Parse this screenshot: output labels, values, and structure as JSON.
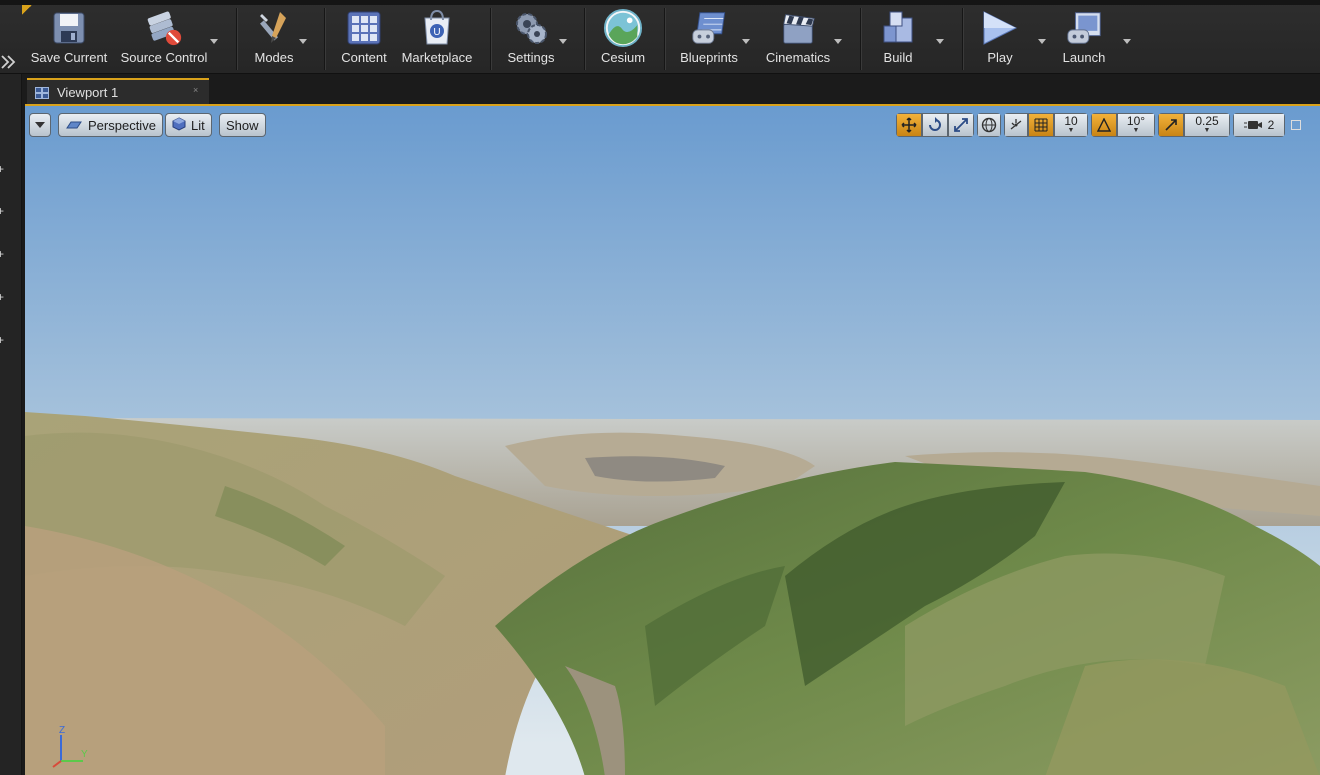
{
  "toolbar": {
    "buttons": [
      {
        "label": "Save Current",
        "icon": "save-icon"
      },
      {
        "label": "Source Control",
        "icon": "source-control-icon"
      },
      {
        "label": "Modes",
        "icon": "modes-icon"
      },
      {
        "label": "Content",
        "icon": "content-icon"
      },
      {
        "label": "Marketplace",
        "icon": "marketplace-icon"
      },
      {
        "label": "Settings",
        "icon": "settings-icon"
      },
      {
        "label": "Cesium",
        "icon": "cesium-icon"
      },
      {
        "label": "Blueprints",
        "icon": "blueprints-icon"
      },
      {
        "label": "Cinematics",
        "icon": "cinematics-icon"
      },
      {
        "label": "Build",
        "icon": "build-icon"
      },
      {
        "label": "Play",
        "icon": "play-icon"
      },
      {
        "label": "Launch",
        "icon": "launch-icon"
      }
    ]
  },
  "tabs": [
    {
      "label": "Viewport 1"
    }
  ],
  "viewport": {
    "view_mode": "Perspective",
    "lighting": "Lit",
    "show": "Show",
    "grid_snap": "10",
    "rotation_snap": "10°",
    "scale_snap": "0.25",
    "camera_speed": "2",
    "axis_labels": {
      "z": "Z",
      "y": "Y"
    }
  },
  "colors": {
    "accent": "#d9a21b",
    "toolbar_bg": "#2a2a2a",
    "sky_top": "#6b9ccf",
    "sky_horizon": "#dfe8ee"
  }
}
